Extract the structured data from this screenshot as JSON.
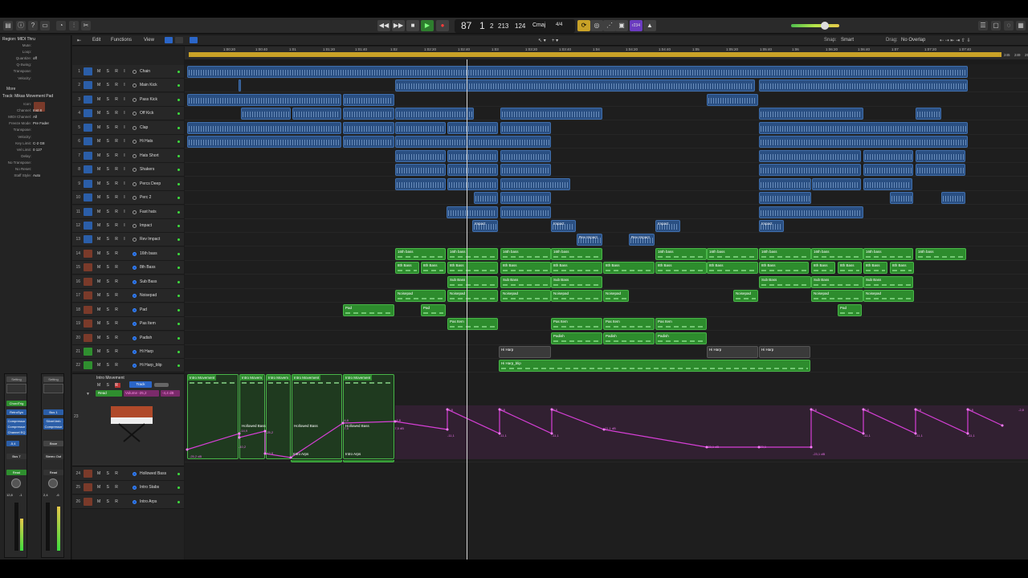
{
  "app": {
    "control_bar": {
      "lcd": {
        "tempo": "87",
        "bar": "1",
        "beat": "2",
        "div": "213",
        "tick": "124",
        "key": "Cmaj",
        "sig": "4/4"
      },
      "counter": "r234"
    },
    "editor_menu": {
      "items": [
        "Edit",
        "Functions",
        "View"
      ],
      "snap_label": "Snap:",
      "snap_value": "Smart",
      "drag_label": "Drag:",
      "drag_value": "No Overlap"
    },
    "inspector": {
      "region_title": "Region: MIDI Thru",
      "region_params": [
        {
          "k": "Mute:",
          "v": ""
        },
        {
          "k": "Loop:",
          "v": ""
        },
        {
          "k": "Quantize:",
          "v": "off"
        },
        {
          "k": "Q-Swing:",
          "v": ""
        },
        {
          "k": "Transpose:",
          "v": ""
        },
        {
          "k": "Velocity:",
          "v": ""
        }
      ],
      "more": "More",
      "track_title": "Track: Mikas Movement Pad",
      "track_params": [
        {
          "k": "Icon:",
          "v": ""
        },
        {
          "k": "Channel:",
          "v": "Inst 8"
        },
        {
          "k": "MIDI Channel:",
          "v": "All"
        },
        {
          "k": "Freeze Mode:",
          "v": "Pre Fader"
        },
        {
          "k": "Transpose:",
          "v": ""
        },
        {
          "k": "Velocity:",
          "v": ""
        },
        {
          "k": "Key Limit:",
          "v": "C-2   G8"
        },
        {
          "k": "Vel Limit:",
          "v": "0   127"
        },
        {
          "k": "Delay:",
          "v": ""
        },
        {
          "k": "No Transpose:",
          "v": ""
        },
        {
          "k": "No Reset:",
          "v": ""
        },
        {
          "k": "Staff Style:",
          "v": "Auto"
        }
      ],
      "strip1": {
        "setting": "Setting",
        "eq": "EQ",
        "chord": "ChordTrig",
        "retro": "RetroSyn",
        "inserts": [
          "Compressor",
          "Compressor",
          "Channel EQ"
        ],
        "pan": "-5,4",
        "send": "Bus 7",
        "mode": "Read",
        "vol": "12,8",
        "peak": "-1"
      },
      "strip2": {
        "setting": "Setting",
        "eq": "EQ",
        "send_top": "Bus 1",
        "inserts": [
          "SilverVerb",
          "Compressor"
        ],
        "bnce": "Bnce",
        "out": "Stereo Out",
        "mode": "Read",
        "vol": "2,4",
        "peak": "-6"
      }
    },
    "ruler": {
      "times": [
        "1:00:20",
        "1:00:40",
        "1:01",
        "1:01:20",
        "1:01:40",
        "1:02",
        "1:02:20",
        "1:02:40",
        "1:03",
        "1:03:20",
        "1:03:40",
        "1:04",
        "1:04:20",
        "1:04:40",
        "1:05",
        "1:05:20",
        "1:05:40",
        "1:06",
        "1:06:20",
        "1:06:40",
        "1:07",
        "1:07:20",
        "1:07:40"
      ],
      "end_bars": [
        "245",
        "249",
        "253",
        "257"
      ]
    },
    "tracks": [
      {
        "n": "1",
        "name": "Chain",
        "kind": "audio"
      },
      {
        "n": "2",
        "name": "Main Kick",
        "kind": "audio"
      },
      {
        "n": "3",
        "name": "Pass Kick",
        "kind": "audio"
      },
      {
        "n": "4",
        "name": "Off Kick",
        "kind": "audio"
      },
      {
        "n": "5",
        "name": "Clap",
        "kind": "audio"
      },
      {
        "n": "6",
        "name": "Hi Hats",
        "kind": "audio"
      },
      {
        "n": "7",
        "name": "Hats Short",
        "kind": "audio"
      },
      {
        "n": "8",
        "name": "Shakers",
        "kind": "audio"
      },
      {
        "n": "9",
        "name": "Percs Deep",
        "kind": "audio"
      },
      {
        "n": "10",
        "name": "Perc 2",
        "kind": "audio"
      },
      {
        "n": "11",
        "name": "Fast hats",
        "kind": "audio"
      },
      {
        "n": "12",
        "name": "Impact",
        "kind": "audio"
      },
      {
        "n": "13",
        "name": "Rev Impact",
        "kind": "audio"
      },
      {
        "n": "14",
        "name": "16th bass",
        "kind": "inst"
      },
      {
        "n": "15",
        "name": "8th Bass",
        "kind": "inst"
      },
      {
        "n": "16",
        "name": "Sub Bass",
        "kind": "inst"
      },
      {
        "n": "17",
        "name": "Noisepad",
        "kind": "inst"
      },
      {
        "n": "18",
        "name": "Pad",
        "kind": "inst"
      },
      {
        "n": "19",
        "name": "Pas Item",
        "kind": "inst"
      },
      {
        "n": "20",
        "name": "Padish",
        "kind": "inst"
      },
      {
        "n": "21",
        "name": "Hi Harp",
        "kind": "drum"
      },
      {
        "n": "22",
        "name": "Hi Harp_blip",
        "kind": "drum"
      }
    ],
    "track23": {
      "n": "23",
      "name": "Intro Movement",
      "btn_track": "Track",
      "mode": "Read",
      "param": "Volume",
      "value": "-25,2",
      "db": "-4,4 dB"
    },
    "tracks_bottom": [
      {
        "n": "24",
        "name": "Hollowed Bass",
        "kind": "inst"
      },
      {
        "n": "25",
        "name": "Intro Stabs",
        "kind": "inst"
      },
      {
        "n": "26",
        "name": "Intro Arps",
        "kind": "inst"
      }
    ],
    "regions": {
      "impact": "Impact",
      "rev_impact": "Rev Impact",
      "sixteenth": "16th bass",
      "eighth": "8th Bass",
      "sub": "Sub Bass",
      "noise": "Noisepad",
      "pad": "Pad",
      "pas": "Pas Item",
      "padish": "Padish",
      "harp": "Hi Harp",
      "harp_blip": "Hi Harp_blip",
      "intro_mov": "Intro Movement",
      "intro_mov_short": "Intro Movem",
      "hollow": "Hollowed Bass",
      "arps": "Intro Arps"
    },
    "automation_labels": [
      "-25,2 dB",
      "-10,2",
      "-14,9",
      "-12,9",
      "-25,2",
      "-4,8",
      "-7,5",
      "-4,8",
      "-7,5 dB",
      "-2,8",
      "-11,1",
      "-2,8",
      "-11,1",
      "-2,8",
      "-11,1",
      "-11,1 dB",
      "-23,1 dB",
      "-23,1",
      "-2,8",
      "-23,1 dB",
      "-2,8",
      "-11,1",
      "-2,8",
      "-11,1",
      "-2,8",
      "-11,1",
      "-2,8"
    ]
  }
}
